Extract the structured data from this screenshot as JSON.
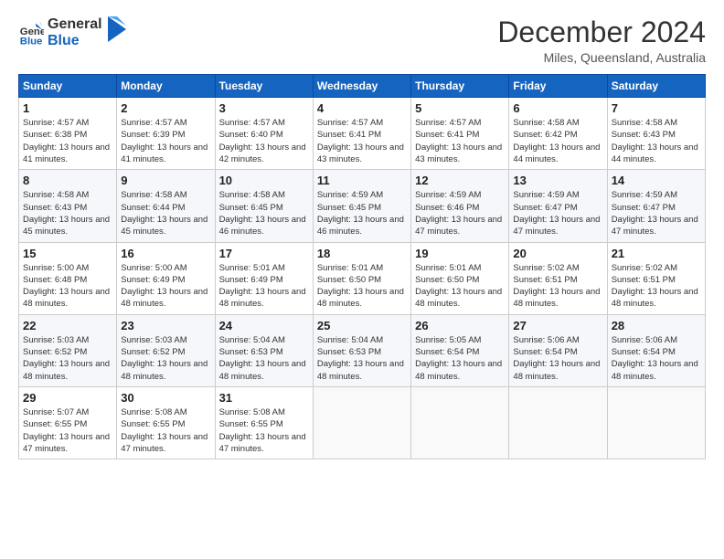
{
  "logo": {
    "line1": "General",
    "line2": "Blue"
  },
  "title": "December 2024",
  "subtitle": "Miles, Queensland, Australia",
  "days_of_week": [
    "Sunday",
    "Monday",
    "Tuesday",
    "Wednesday",
    "Thursday",
    "Friday",
    "Saturday"
  ],
  "weeks": [
    [
      {
        "day": 1,
        "sunrise": "4:57 AM",
        "sunset": "6:38 PM",
        "daylight": "13 hours and 41 minutes."
      },
      {
        "day": 2,
        "sunrise": "4:57 AM",
        "sunset": "6:39 PM",
        "daylight": "13 hours and 41 minutes."
      },
      {
        "day": 3,
        "sunrise": "4:57 AM",
        "sunset": "6:40 PM",
        "daylight": "13 hours and 42 minutes."
      },
      {
        "day": 4,
        "sunrise": "4:57 AM",
        "sunset": "6:41 PM",
        "daylight": "13 hours and 43 minutes."
      },
      {
        "day": 5,
        "sunrise": "4:57 AM",
        "sunset": "6:41 PM",
        "daylight": "13 hours and 43 minutes."
      },
      {
        "day": 6,
        "sunrise": "4:58 AM",
        "sunset": "6:42 PM",
        "daylight": "13 hours and 44 minutes."
      },
      {
        "day": 7,
        "sunrise": "4:58 AM",
        "sunset": "6:43 PM",
        "daylight": "13 hours and 44 minutes."
      }
    ],
    [
      {
        "day": 8,
        "sunrise": "4:58 AM",
        "sunset": "6:43 PM",
        "daylight": "13 hours and 45 minutes."
      },
      {
        "day": 9,
        "sunrise": "4:58 AM",
        "sunset": "6:44 PM",
        "daylight": "13 hours and 45 minutes."
      },
      {
        "day": 10,
        "sunrise": "4:58 AM",
        "sunset": "6:45 PM",
        "daylight": "13 hours and 46 minutes."
      },
      {
        "day": 11,
        "sunrise": "4:59 AM",
        "sunset": "6:45 PM",
        "daylight": "13 hours and 46 minutes."
      },
      {
        "day": 12,
        "sunrise": "4:59 AM",
        "sunset": "6:46 PM",
        "daylight": "13 hours and 47 minutes."
      },
      {
        "day": 13,
        "sunrise": "4:59 AM",
        "sunset": "6:47 PM",
        "daylight": "13 hours and 47 minutes."
      },
      {
        "day": 14,
        "sunrise": "4:59 AM",
        "sunset": "6:47 PM",
        "daylight": "13 hours and 47 minutes."
      }
    ],
    [
      {
        "day": 15,
        "sunrise": "5:00 AM",
        "sunset": "6:48 PM",
        "daylight": "13 hours and 48 minutes."
      },
      {
        "day": 16,
        "sunrise": "5:00 AM",
        "sunset": "6:49 PM",
        "daylight": "13 hours and 48 minutes."
      },
      {
        "day": 17,
        "sunrise": "5:01 AM",
        "sunset": "6:49 PM",
        "daylight": "13 hours and 48 minutes."
      },
      {
        "day": 18,
        "sunrise": "5:01 AM",
        "sunset": "6:50 PM",
        "daylight": "13 hours and 48 minutes."
      },
      {
        "day": 19,
        "sunrise": "5:01 AM",
        "sunset": "6:50 PM",
        "daylight": "13 hours and 48 minutes."
      },
      {
        "day": 20,
        "sunrise": "5:02 AM",
        "sunset": "6:51 PM",
        "daylight": "13 hours and 48 minutes."
      },
      {
        "day": 21,
        "sunrise": "5:02 AM",
        "sunset": "6:51 PM",
        "daylight": "13 hours and 48 minutes."
      }
    ],
    [
      {
        "day": 22,
        "sunrise": "5:03 AM",
        "sunset": "6:52 PM",
        "daylight": "13 hours and 48 minutes."
      },
      {
        "day": 23,
        "sunrise": "5:03 AM",
        "sunset": "6:52 PM",
        "daylight": "13 hours and 48 minutes."
      },
      {
        "day": 24,
        "sunrise": "5:04 AM",
        "sunset": "6:53 PM",
        "daylight": "13 hours and 48 minutes."
      },
      {
        "day": 25,
        "sunrise": "5:04 AM",
        "sunset": "6:53 PM",
        "daylight": "13 hours and 48 minutes."
      },
      {
        "day": 26,
        "sunrise": "5:05 AM",
        "sunset": "6:54 PM",
        "daylight": "13 hours and 48 minutes."
      },
      {
        "day": 27,
        "sunrise": "5:06 AM",
        "sunset": "6:54 PM",
        "daylight": "13 hours and 48 minutes."
      },
      {
        "day": 28,
        "sunrise": "5:06 AM",
        "sunset": "6:54 PM",
        "daylight": "13 hours and 48 minutes."
      }
    ],
    [
      {
        "day": 29,
        "sunrise": "5:07 AM",
        "sunset": "6:55 PM",
        "daylight": "13 hours and 47 minutes."
      },
      {
        "day": 30,
        "sunrise": "5:08 AM",
        "sunset": "6:55 PM",
        "daylight": "13 hours and 47 minutes."
      },
      {
        "day": 31,
        "sunrise": "5:08 AM",
        "sunset": "6:55 PM",
        "daylight": "13 hours and 47 minutes."
      },
      null,
      null,
      null,
      null
    ]
  ],
  "sunrise_label": "Sunrise:",
  "sunset_label": "Sunset:",
  "daylight_label": "Daylight:"
}
